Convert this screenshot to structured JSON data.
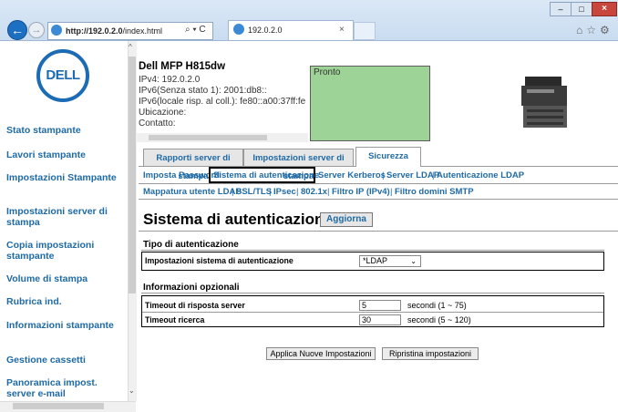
{
  "browser": {
    "address": "http://192.0.2.0/index.html",
    "address_host": "http://192.0.2.0",
    "address_path": "/index.html",
    "address_tools": "⌕ ▾ C",
    "tab_title": "192.0.2.0",
    "tab_close": "×"
  },
  "left": {
    "logo_text": "DELL",
    "nav": [
      "Stato stampante",
      "Lavori stampante",
      "Impostazioni Stampante",
      "Impostazioni server di stampa",
      "Copia impostazioni stampante",
      "Volume di stampa",
      "Rubrica ind.",
      "Informazioni stampante",
      "Gestione cassetti",
      "Panoramica impost. server e-mail"
    ]
  },
  "printer": {
    "name": "Dell MFP H815dw",
    "info": [
      "IPv4: 192.0.2.0",
      "IPv6(Senza stato 1): 2001:db8::",
      "IPv6(locale risp. al coll.): fe80::a00:37ff:fe",
      "Ubicazione:",
      "Contatto:"
    ],
    "status": "Pronto",
    "status_color": "#9dd396"
  },
  "tabs": [
    "Rapporti server di stampa",
    "Impostazioni server di stampa",
    "Sicurezza"
  ],
  "subnav": {
    "row1": [
      "Imposta Password",
      "Sistema di autenticazione",
      "Server Kerberos",
      "Server LDAP",
      "Autenticazione LDAP"
    ],
    "row2": [
      "Mappatura utente LDAP",
      "SSL/TLS",
      "IPsec",
      "802.1x",
      "Filtro IP (IPv4)",
      "Filtro domini SMTP"
    ],
    "separator": "|"
  },
  "page": {
    "title": "Sistema di autenticazione -",
    "refresh_label": "Aggiorna"
  },
  "auth_type": {
    "heading": "Tipo di autenticazione",
    "label": "Impostazioni sistema di autenticazione",
    "value": "*LDAP"
  },
  "optional": {
    "heading": "Informazioni opzionali",
    "rows": [
      {
        "label": "Timeout di risposta server",
        "value": "5",
        "unit": "secondi (1 ~ 75)"
      },
      {
        "label": "Timeout ricerca",
        "value": "30",
        "unit": "secondi (5 ~ 120)"
      }
    ]
  },
  "buttons": {
    "apply": "Applica Nuove Impostazioni",
    "restore": "Ripristina impostazioni"
  },
  "colors": {
    "link": "#1f6aa5",
    "dell_blue": "#1b6bb5"
  }
}
